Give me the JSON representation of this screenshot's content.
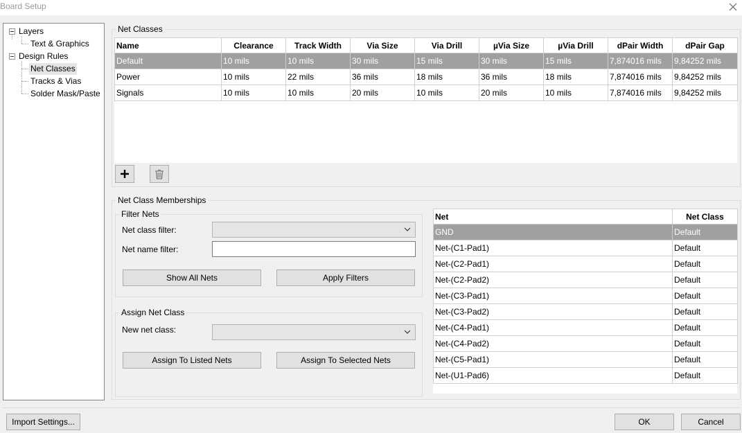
{
  "window": {
    "title": "Board Setup"
  },
  "tree": {
    "items": [
      {
        "label": "Layers"
      },
      {
        "label": "Text & Graphics"
      },
      {
        "label": "Design Rules"
      },
      {
        "label": "Net Classes"
      },
      {
        "label": "Tracks & Vias"
      },
      {
        "label": "Solder Mask/Paste"
      }
    ]
  },
  "net_classes": {
    "group_title": "Net Classes",
    "columns": [
      "Name",
      "Clearance",
      "Track Width",
      "Via Size",
      "Via Drill",
      "µVia Size",
      "µVia Drill",
      "dPair Width",
      "dPair Gap"
    ],
    "rows": [
      [
        "Default",
        "10 mils",
        "10 mils",
        "30 mils",
        "15 mils",
        "30 mils",
        "15 mils",
        "7,874016 mils",
        "9,84252 mils"
      ],
      [
        "Power",
        "10 mils",
        "22 mils",
        "36 mils",
        "18 mils",
        "36 mils",
        "18 mils",
        "7,874016 mils",
        "9,84252 mils"
      ],
      [
        "Signals",
        "10 mils",
        "10 mils",
        "20 mils",
        "10 mils",
        "20 mils",
        "10 mils",
        "7,874016 mils",
        "9,84252 mils"
      ]
    ]
  },
  "memberships": {
    "group_title": "Net Class Memberships",
    "filter": {
      "group_title": "Filter Nets",
      "class_filter_label": "Net class filter:",
      "class_filter_value": "",
      "name_filter_label": "Net name filter:",
      "name_filter_value": "",
      "show_all_label": "Show All Nets",
      "apply_label": "Apply Filters"
    },
    "assign": {
      "group_title": "Assign Net Class",
      "new_class_label": "New net class:",
      "new_class_value": "",
      "assign_listed_label": "Assign To Listed Nets",
      "assign_selected_label": "Assign To Selected Nets"
    },
    "nets": {
      "columns": [
        "Net",
        "Net Class"
      ],
      "rows": [
        [
          "GND",
          "Default"
        ],
        [
          "Net-(C1-Pad1)",
          "Default"
        ],
        [
          "Net-(C2-Pad1)",
          "Default"
        ],
        [
          "Net-(C2-Pad2)",
          "Default"
        ],
        [
          "Net-(C3-Pad1)",
          "Default"
        ],
        [
          "Net-(C3-Pad2)",
          "Default"
        ],
        [
          "Net-(C4-Pad1)",
          "Default"
        ],
        [
          "Net-(C4-Pad2)",
          "Default"
        ],
        [
          "Net-(C5-Pad1)",
          "Default"
        ],
        [
          "Net-(U1-Pad6)",
          "Default"
        ]
      ]
    }
  },
  "footer": {
    "import_label": "Import Settings...",
    "ok_label": "OK",
    "cancel_label": "Cancel"
  },
  "icons": {
    "add": "plus-icon",
    "delete": "trash-icon",
    "close": "close-icon",
    "dropdown": "chevron-down-icon"
  }
}
